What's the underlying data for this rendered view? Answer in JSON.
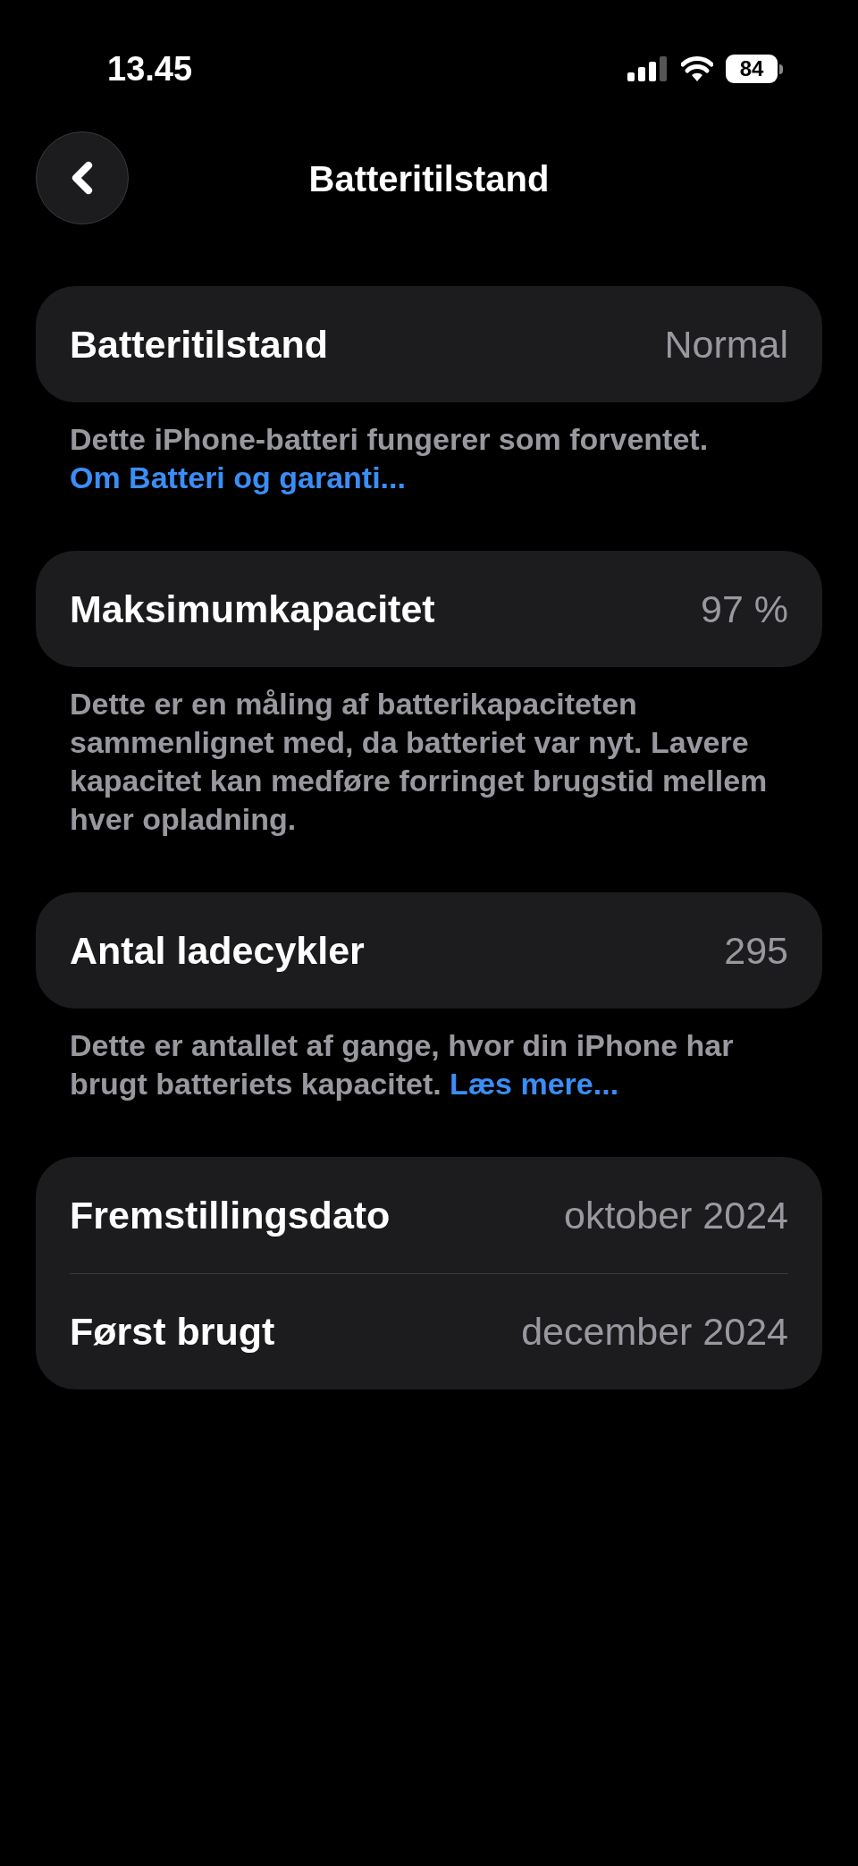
{
  "status_bar": {
    "time": "13.45",
    "battery": "84"
  },
  "nav": {
    "title": "Batteritilstand"
  },
  "sections": [
    {
      "rows": [
        {
          "label": "Batteritilstand",
          "value": "Normal"
        }
      ],
      "footer": {
        "text": "Dette iPhone-batteri fungerer som forventet.",
        "link": "Om Batteri og garanti..."
      }
    },
    {
      "rows": [
        {
          "label": "Maksimumkapacitet",
          "value": "97 %"
        }
      ],
      "footer": {
        "text": "Dette er en måling af batterikapaciteten sammenlignet med, da batteriet var nyt. Lavere kapacitet kan medføre forringet brugstid mellem hver opladning."
      }
    },
    {
      "rows": [
        {
          "label": "Antal ladecykler",
          "value": "295"
        }
      ],
      "footer": {
        "text": "Dette er antallet af gange, hvor din iPhone har brugt batteriets kapacitet.",
        "link": "Læs mere..."
      }
    },
    {
      "rows": [
        {
          "label": "Fremstillingsdato",
          "value": "oktober 2024"
        },
        {
          "label": "Først brugt",
          "value": "december 2024"
        }
      ]
    }
  ]
}
